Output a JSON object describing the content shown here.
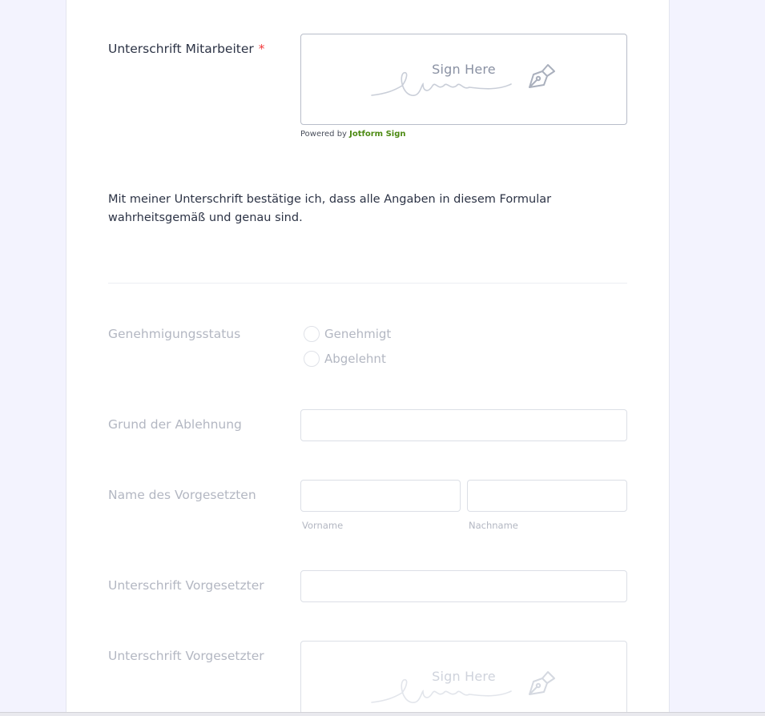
{
  "form": {
    "employee_signature": {
      "label": "Unterschrift Mitarbeiter",
      "required_mark": "*",
      "sign_here": "Sign Here",
      "powered_by": "Powered by",
      "powered_brand": "Jotform Sign"
    },
    "confirmation_text": "Mit meiner Unterschrift bestätige ich, dass alle Angaben in diesem Formular wahrheitsgemäß und genau sind.",
    "approval_status": {
      "label": "Genehmigungsstatus",
      "options": [
        "Genehmigt",
        "Abgelehnt"
      ]
    },
    "rejection_reason": {
      "label": "Grund der Ablehnung",
      "value": ""
    },
    "supervisor_name": {
      "label": "Name des Vorgesetzten",
      "first_sublabel": "Vorname",
      "last_sublabel": "Nachname",
      "first_value": "",
      "last_value": ""
    },
    "supervisor_signature_text": {
      "label": "Unterschrift Vorgesetzter",
      "value": ""
    },
    "supervisor_signature_pad": {
      "label": "Unterschrift Vorgesetzter",
      "sign_here": "Sign Here"
    }
  },
  "colors": {
    "page_background": "#f3f3fe",
    "card_background": "#ffffff",
    "label_text": "#2c3345",
    "muted_text": "#b3b7c2",
    "required": "#f23a3c",
    "brand": "#4c8a12"
  }
}
